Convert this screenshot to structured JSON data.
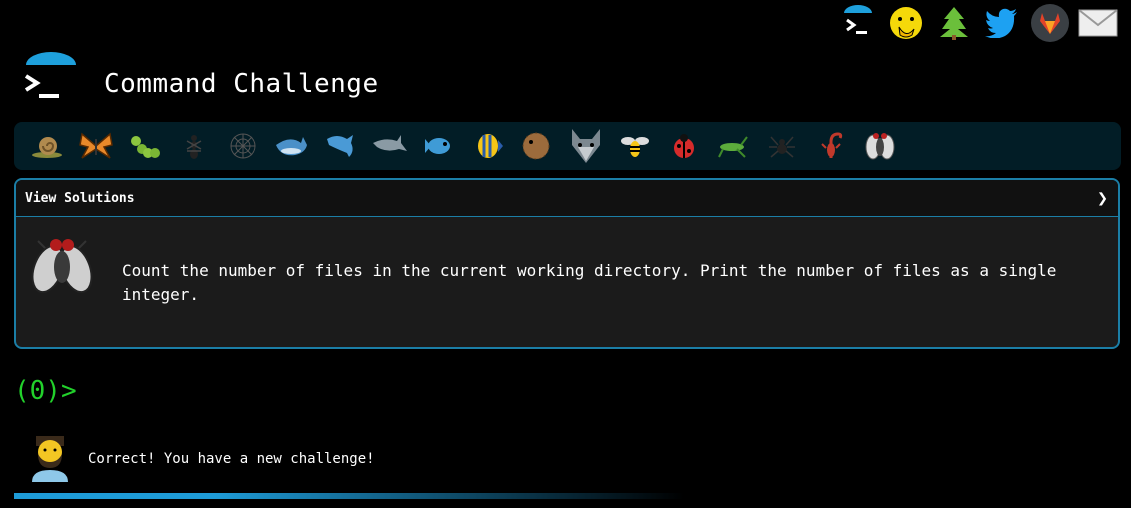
{
  "header": {
    "title": "Command Challenge"
  },
  "top_icons": [
    {
      "name": "terminal-icon"
    },
    {
      "name": "hand-over-mouth-face-icon"
    },
    {
      "name": "tree-icon"
    },
    {
      "name": "twitter-icon"
    },
    {
      "name": "gitlab-icon"
    },
    {
      "name": "mail-icon"
    }
  ],
  "animals": [
    "snail",
    "butterfly",
    "caterpillar",
    "ant",
    "spider-web",
    "whale",
    "dolphin-blue",
    "dolphin-gray",
    "fish",
    "tropical-fish",
    "blowfish",
    "wolf",
    "bee",
    "ladybug",
    "cricket",
    "spider",
    "scorpion",
    "fly"
  ],
  "panel": {
    "header_label": "View Solutions",
    "chevron": "❯",
    "challenge_text": "Count the number of files in the current working directory. Print the number of files as a single integer."
  },
  "prompt": "(0)>",
  "feedback": {
    "message": "Correct! You have a new challenge!"
  },
  "colors": {
    "accent": "#1b7ea6",
    "prompt": "#22d12b",
    "bar": "#021d26"
  }
}
